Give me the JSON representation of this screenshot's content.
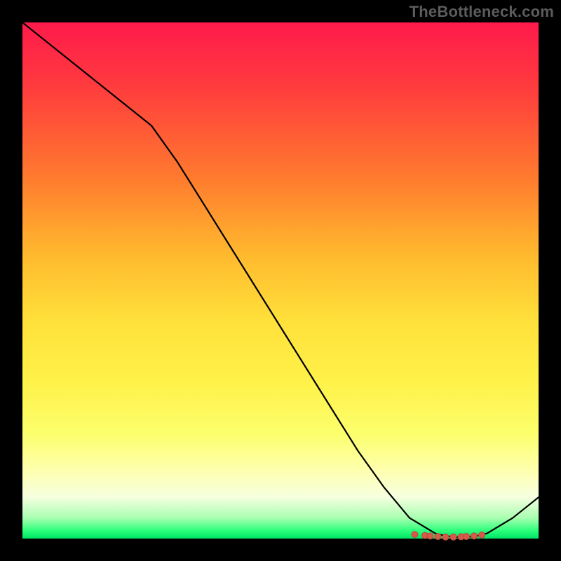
{
  "watermark": "TheBottleneck.com",
  "colors": {
    "frame_bg": "#000000",
    "curve_stroke": "#000000",
    "marker_fill": "#d55a4a",
    "marker_stroke": "#b84a3c",
    "gradient_stops": [
      "#ff1a4b",
      "#ff3a3e",
      "#ff7a2e",
      "#ffb92e",
      "#ffe13a",
      "#fff24a",
      "#fcff6e",
      "#feffb0",
      "#f6ffe0",
      "#a8ffb0",
      "#2aff7a",
      "#00e466"
    ]
  },
  "chart_data": {
    "type": "line",
    "title": "",
    "xlabel": "",
    "ylabel": "",
    "xlim": [
      0,
      100
    ],
    "ylim": [
      0,
      100
    ],
    "x": [
      0,
      5,
      10,
      15,
      20,
      25,
      30,
      35,
      40,
      45,
      50,
      55,
      60,
      65,
      70,
      75,
      80,
      82,
      84,
      86,
      88,
      90,
      95,
      100
    ],
    "values": [
      100,
      96,
      92,
      88,
      84,
      80,
      73,
      65,
      57,
      49,
      41,
      33,
      25,
      17,
      10,
      4,
      1,
      0.5,
      0.3,
      0.3,
      0.5,
      1,
      4,
      8
    ],
    "markers": {
      "x": [
        76,
        78,
        79,
        80.5,
        82,
        83.5,
        85,
        86,
        87.5,
        89
      ],
      "y": [
        0.8,
        0.6,
        0.5,
        0.4,
        0.3,
        0.3,
        0.35,
        0.4,
        0.5,
        0.7
      ]
    },
    "notes": "Axes are normalized 0–100 (no tick labels visible). Curve descends from top-left, flattens near x≈80–90 at y≈0, then rises slightly toward x=100. Markers cluster at the trough."
  }
}
